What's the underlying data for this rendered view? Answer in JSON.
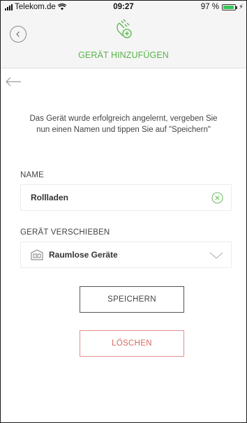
{
  "status_bar": {
    "carrier": "Telekom.de",
    "time": "09:27",
    "battery": "97 %",
    "battery_level": 0.97,
    "battery_color": "#35c759"
  },
  "header": {
    "title": "GERÄT HINZUFÜGEN",
    "back_icon": "chevron-left-circle-icon",
    "device_icon": "plug-add-icon",
    "accent_color": "#58b34a"
  },
  "instruction": "Das Gerät wurde erfolgreich angelernt, vergeben Sie nun einen Namen und tippen Sie auf \"Speichern\"",
  "name_section": {
    "label": "NAME",
    "value": "Rollladen",
    "clear_icon": "clear-circle-icon"
  },
  "move_section": {
    "label": "GERÄT VERSCHIEBEN",
    "selected": "Raumlose Geräte",
    "room_icon": "room-icon",
    "dropdown_icon": "chevron-down-icon"
  },
  "buttons": {
    "save": "SPEICHERN",
    "delete": "LÖSCHEN",
    "delete_color": "#d9685f"
  }
}
